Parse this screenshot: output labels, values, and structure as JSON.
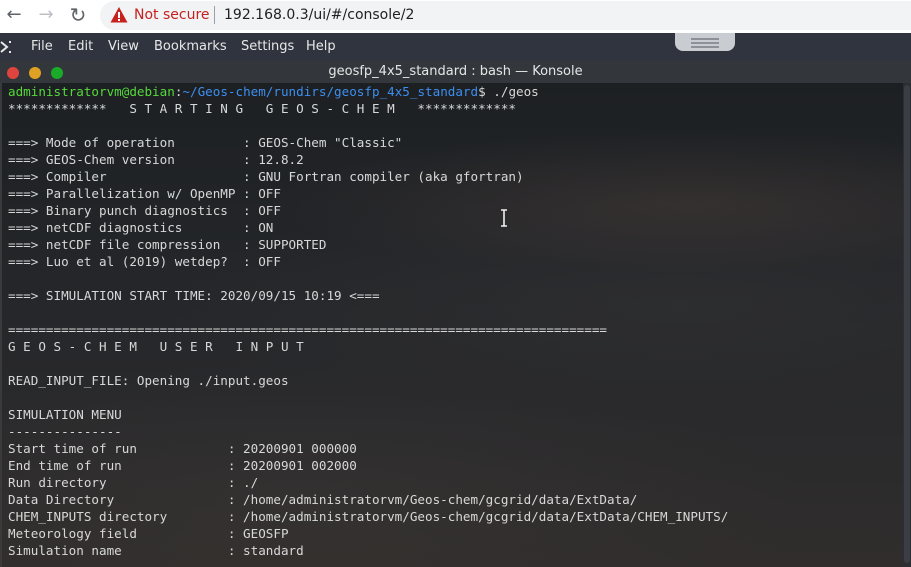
{
  "browser": {
    "back": "←",
    "forward": "→",
    "reload": "↻",
    "security_label": "Not secure",
    "url": "192.168.0.3/ui/#/console/2"
  },
  "menubar": {
    "items": [
      "File",
      "Edit",
      "View",
      "Bookmarks",
      "Settings",
      "Help"
    ]
  },
  "window": {
    "title": "geosfp_4x5_standard : bash — Konsole",
    "buttons": {
      "close": "#e0443e",
      "minimize": "#dea123",
      "maximize": "#1aab29"
    }
  },
  "terminal": {
    "prompt": {
      "user": "administratorvm@debian",
      "colon": ":",
      "path": "~/Geos-chem/rundirs/geosfp_4x5_standard",
      "suffix": "$ ./geos"
    },
    "lines": [
      "*************   S T A R T I N G   G E O S - C H E M   *************",
      "",
      "===> Mode of operation         : GEOS-Chem \"Classic\"",
      "===> GEOS-Chem version         : 12.8.2",
      "===> Compiler                  : GNU Fortran compiler (aka gfortran)",
      "===> Parallelization w/ OpenMP : OFF",
      "===> Binary punch diagnostics  : OFF",
      "===> netCDF diagnostics        : ON",
      "===> netCDF file compression   : SUPPORTED",
      "===> Luo et al (2019) wetdep?  : OFF",
      "",
      "===> SIMULATION START TIME: 2020/09/15 10:19 <===",
      "",
      "===============================================================================",
      "G E O S - C H E M   U S E R   I N P U T",
      "",
      "READ_INPUT_FILE: Opening ./input.geos",
      "",
      "SIMULATION MENU",
      "---------------",
      "Start time of run            : 20200901 000000",
      "End time of run              : 20200901 002000",
      "Run directory                : ./",
      "Data Directory               : /home/administratorvm/Geos-chem/gcgrid/data/ExtData/",
      "CHEM_INPUTS directory        : /home/administratorvm/Geos-chem/gcgrid/data/ExtData/CHEM_INPUTS/",
      "Meteorology field            : GEOSFP",
      "Simulation name              : standard"
    ]
  }
}
